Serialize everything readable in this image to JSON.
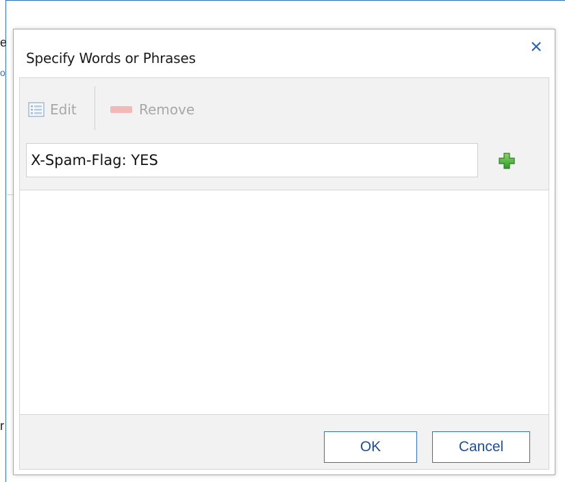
{
  "background": {
    "fragments": [
      "e",
      "o",
      "r"
    ]
  },
  "dialog": {
    "title": "Specify Words or Phrases",
    "close_icon": "close-icon"
  },
  "toolbar": {
    "edit_label": "Edit",
    "remove_label": "Remove",
    "edit_icon": "list-edit-icon",
    "remove_icon": "remove-minus-icon"
  },
  "phrase_input": {
    "value": "X-Spam-Flag: YES"
  },
  "add_button": {
    "icon": "plus-icon",
    "color": "#3fa93a"
  },
  "footer": {
    "ok_label": "OK",
    "cancel_label": "Cancel"
  },
  "colors": {
    "accent": "#2f6fb8",
    "button_text": "#1f4f91",
    "disabled_text": "#a7a7a7",
    "remove_icon": "#f3b9b9"
  }
}
